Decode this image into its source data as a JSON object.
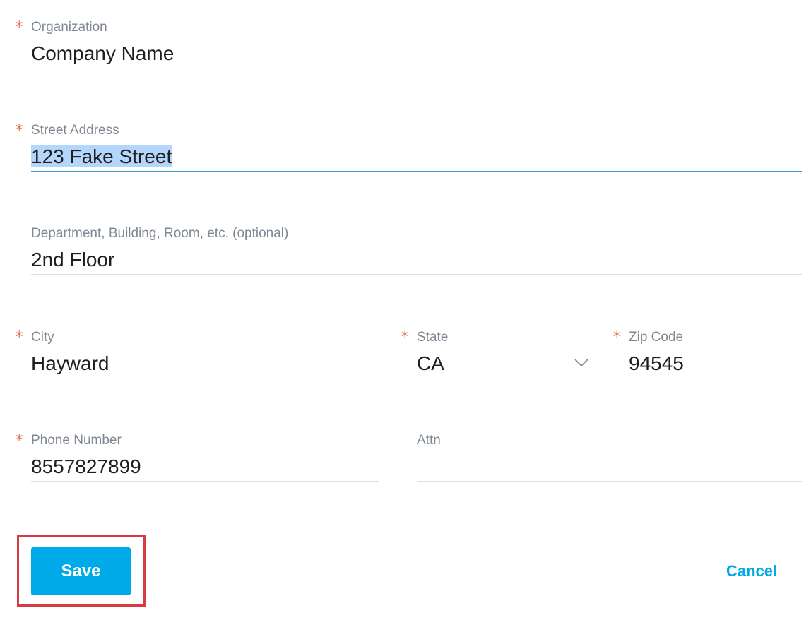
{
  "form": {
    "organization": {
      "label": "Organization",
      "value": "Company Name",
      "required": true
    },
    "street": {
      "label": "Street Address",
      "value": "123 Fake Street",
      "required": true
    },
    "department": {
      "label": "Department, Building, Room, etc. (optional)",
      "value": "2nd Floor",
      "required": false
    },
    "city": {
      "label": "City",
      "value": "Hayward",
      "required": true
    },
    "state": {
      "label": "State",
      "value": "CA",
      "required": true
    },
    "zip": {
      "label": "Zip Code",
      "value": "94545",
      "required": true
    },
    "phone": {
      "label": "Phone Number",
      "value": "8557827899",
      "required": true
    },
    "attn": {
      "label": "Attn",
      "value": "",
      "required": false
    },
    "required_marker": "*"
  },
  "actions": {
    "save_label": "Save",
    "cancel_label": "Cancel"
  },
  "colors": {
    "accent": "#00a9e8",
    "required": "#ee6c4d",
    "highlight_outline": "#d63b45",
    "selection": "#b4d6fb",
    "focus_underline": "#3a9bd5"
  },
  "icons": {
    "state_dropdown": "chevron-down-icon"
  }
}
